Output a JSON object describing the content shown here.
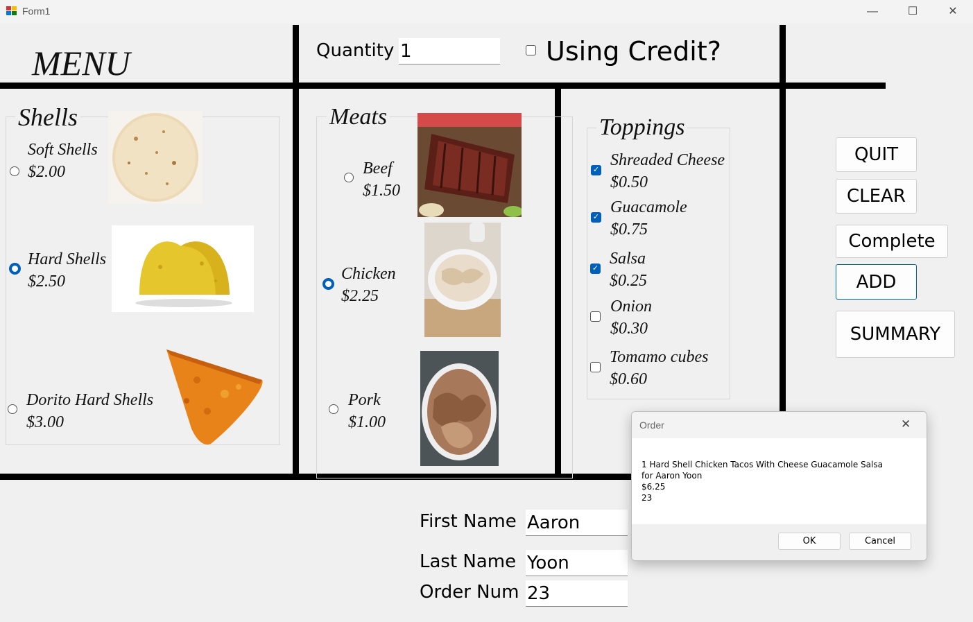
{
  "window": {
    "title": "Form1",
    "minimize": "—",
    "maximize": "☐",
    "close": "✕"
  },
  "header": {
    "menu_title": "MENU",
    "quantity_label": "Quantity",
    "quantity_value": "1",
    "credit_label": "Using Credit?",
    "credit_checked": false
  },
  "shells": {
    "legend": "Shells",
    "items": [
      {
        "name": "Soft Shells",
        "price": "$2.00",
        "selected": false
      },
      {
        "name": "Hard Shells",
        "price": "$2.50",
        "selected": true
      },
      {
        "name": "Dorito Hard Shells",
        "price": "$3.00",
        "selected": false
      }
    ]
  },
  "meats": {
    "legend": "Meats",
    "items": [
      {
        "name": "Beef",
        "price": "$1.50",
        "selected": false
      },
      {
        "name": "Chicken",
        "price": "$2.25",
        "selected": true
      },
      {
        "name": "Pork",
        "price": "$1.00",
        "selected": false
      }
    ]
  },
  "toppings": {
    "legend": "Toppings",
    "items": [
      {
        "name": "Shreaded Cheese",
        "price": "$0.50",
        "checked": true
      },
      {
        "name": "Guacamole",
        "price": "$0.75",
        "checked": true
      },
      {
        "name": "Salsa",
        "price": "$0.25",
        "checked": true
      },
      {
        "name": "Onion",
        "price": "$0.30",
        "checked": false
      },
      {
        "name": "Tomamo cubes",
        "price": "$0.60",
        "checked": false
      }
    ]
  },
  "actions": {
    "quit": "QUIT",
    "clear": "CLEAR",
    "complete": "Complete",
    "add": "ADD",
    "summary": "SUMMARY"
  },
  "customer": {
    "first_name_label": "First Name",
    "first_name": "Aaron",
    "last_name_label": "Last Name",
    "last_name": "Yoon",
    "order_num_label": "Order Num",
    "order_num": "23"
  },
  "dialog": {
    "title": "Order",
    "line1": "1 Hard Shell Chicken Tacos With Cheese Guacamole Salsa",
    "line2": "for Aaron Yoon",
    "line3": "$6.25",
    "line4": "23",
    "ok": "OK",
    "cancel": "Cancel"
  },
  "colors": {
    "accent": "#005fb8",
    "divider": "#000000",
    "background": "#f0f0f0"
  }
}
